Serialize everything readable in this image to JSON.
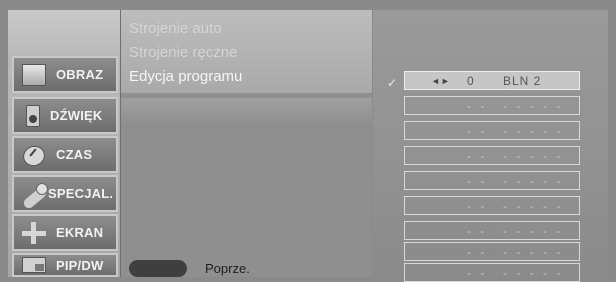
{
  "menu": {
    "items": [
      {
        "label": "OBRAZ",
        "icon": "picture-icon"
      },
      {
        "label": "DŹWIĘK",
        "icon": "speaker-icon"
      },
      {
        "label": "CZAS",
        "icon": "clock-icon"
      },
      {
        "label": "SPECJAL.",
        "icon": "special-icon"
      },
      {
        "label": "EKRAN",
        "icon": "screen-icon"
      },
      {
        "label": "PIP/DW",
        "icon": "pip-icon"
      }
    ]
  },
  "submenu": {
    "items": [
      {
        "label": "Strojenie auto"
      },
      {
        "label": "Strojenie ręczne"
      },
      {
        "label": "Edycja programu"
      }
    ],
    "back_label": "Poprze."
  },
  "program_table": {
    "check_mark": "✓",
    "rows": [
      {
        "arrows": "◄►",
        "number": "0",
        "name": "BLN 2"
      },
      {
        "arrows": "",
        "number": "- -",
        "name": "- - - - -"
      },
      {
        "arrows": "",
        "number": "- -",
        "name": "- - - - -"
      },
      {
        "arrows": "",
        "number": "- -",
        "name": "- - - - -"
      },
      {
        "arrows": "",
        "number": "- -",
        "name": "- - - - -"
      },
      {
        "arrows": "",
        "number": "- -",
        "name": "- - - - -"
      },
      {
        "arrows": "",
        "number": "- -",
        "name": "- - - - -"
      },
      {
        "arrows": "",
        "number": "- -",
        "name": "- - - - -"
      },
      {
        "arrows": "",
        "number": "- -",
        "name": "- - - - -"
      }
    ]
  }
}
